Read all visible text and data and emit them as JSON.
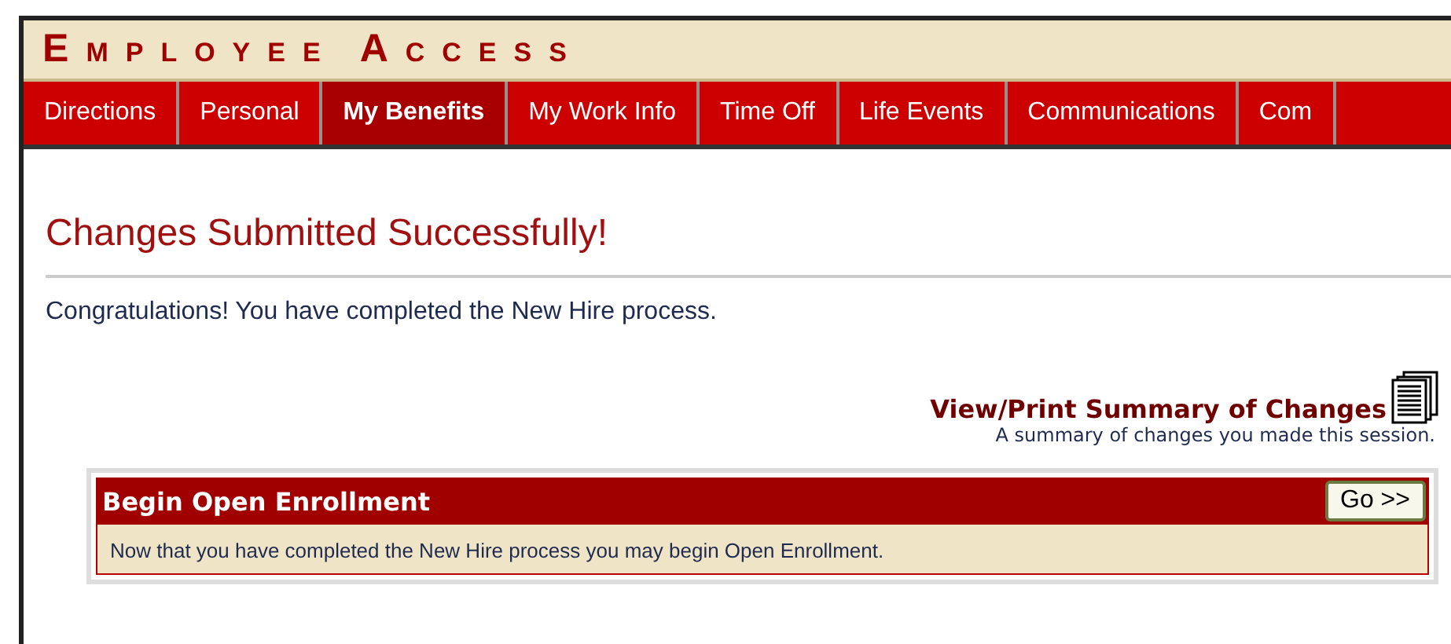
{
  "header": {
    "title": "EMPLOYEE ACCESS"
  },
  "tabs": [
    {
      "label": "Directions",
      "selected": false
    },
    {
      "label": "Personal",
      "selected": false
    },
    {
      "label": "My Benefits",
      "selected": true
    },
    {
      "label": "My Work Info",
      "selected": false
    },
    {
      "label": "Time Off",
      "selected": false
    },
    {
      "label": "Life Events",
      "selected": false
    },
    {
      "label": "Communications",
      "selected": false
    },
    {
      "label": "Com",
      "selected": false
    }
  ],
  "heading": "Changes Submitted Successfully!",
  "message": "Congratulations! You have completed the New Hire process.",
  "summary": {
    "link": "View/Print Summary of Changes",
    "caption": "A summary of changes you made this session."
  },
  "panel": {
    "title": "Begin Open Enrollment",
    "button": "Go >>",
    "text": "Now that you have completed the New Hire process you may begin Open Enrollment."
  }
}
